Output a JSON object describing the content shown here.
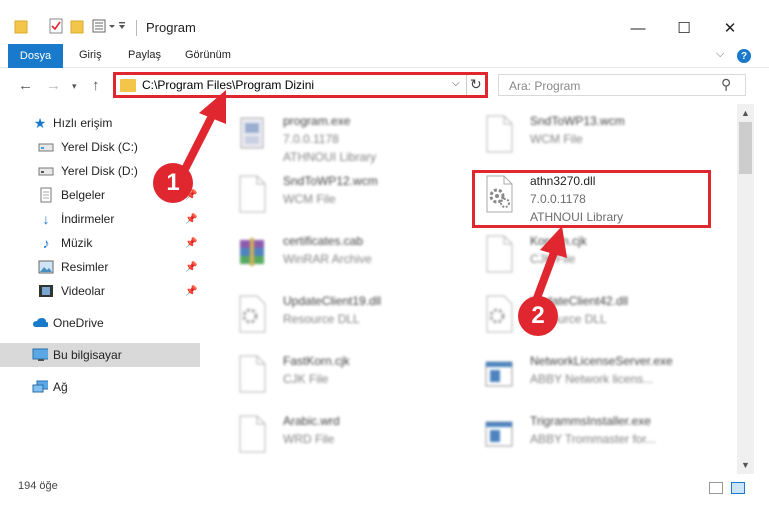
{
  "window": {
    "title": "Program",
    "minimize": "—",
    "maximize": "☐",
    "close": "✕"
  },
  "ribbon": {
    "file_tab": "Dosya",
    "tabs": [
      "Giriş",
      "Paylaş",
      "Görünüm"
    ],
    "help": "?"
  },
  "nav": {
    "address": "C:\\Program Files\\Program Dizini",
    "search_placeholder": "Ara: Program"
  },
  "sidebar": {
    "items": [
      {
        "label": "Hızlı erişim",
        "icon": "star-icon"
      },
      {
        "label": "Yerel Disk (C:)",
        "icon": "drive-icon"
      },
      {
        "label": "Yerel Disk (D:)",
        "icon": "drive-icon"
      },
      {
        "label": "Belgeler",
        "icon": "documents-icon"
      },
      {
        "label": "İndirmeler",
        "icon": "download-icon"
      },
      {
        "label": "Müzik",
        "icon": "music-icon"
      },
      {
        "label": "Resimler",
        "icon": "pictures-icon"
      },
      {
        "label": "Videolar",
        "icon": "video-icon"
      },
      {
        "label": "OneDrive",
        "icon": "cloud-icon"
      },
      {
        "label": "Bu bilgisayar",
        "icon": "computer-icon"
      },
      {
        "label": "Ağ",
        "icon": "network-icon"
      }
    ]
  },
  "files": [
    {
      "name": "program.exe",
      "version": "7.0.0.1178",
      "desc": "ATHNOUI Library"
    },
    {
      "name": "SndToWP13.wcm",
      "version": "",
      "desc": "WCM File"
    },
    {
      "name": "SndToWP12.wcm",
      "version": "",
      "desc": "WCM File"
    },
    {
      "name": "athn3270.dll",
      "version": "7.0.0.1178",
      "desc": "ATHNOUI Library"
    },
    {
      "name": "certificates.cab",
      "version": "",
      "desc": "WinRAR Archive"
    },
    {
      "name": "Korean.cjk",
      "version": "",
      "desc": "CJK File"
    },
    {
      "name": "UpdateClient19.dll",
      "version": "",
      "desc": "Resource DLL"
    },
    {
      "name": "UpdateClient42.dll",
      "version": "",
      "desc": "Resource DLL"
    },
    {
      "name": "FastKorn.cjk",
      "version": "",
      "desc": "CJK File"
    },
    {
      "name": "NetworkLicenseServer.exe",
      "version": "",
      "desc": "ABBY Network licens..."
    },
    {
      "name": "Arabic.wrd",
      "version": "",
      "desc": "WRD File"
    },
    {
      "name": "TrigrammsInstaller.exe",
      "version": "",
      "desc": "ABBY Trommaster for..."
    }
  ],
  "status": {
    "count": "194 öğe"
  },
  "callouts": [
    "1",
    "2"
  ]
}
